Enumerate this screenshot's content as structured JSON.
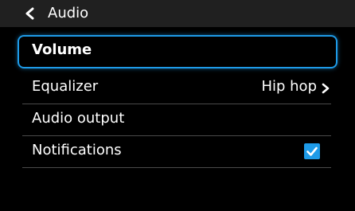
{
  "header": {
    "title": "Audio",
    "back_icon": "chevron-left-icon"
  },
  "menu": {
    "items": [
      {
        "label": "Volume",
        "selected": true
      },
      {
        "label": "Equalizer",
        "value": "Hip hop",
        "icon": "chevron-right-icon"
      },
      {
        "label": "Audio output"
      },
      {
        "label": "Notifications",
        "checked": true,
        "icon": "check-icon"
      }
    ]
  },
  "colors": {
    "background": "#000000",
    "header_background": "#202020",
    "accent": "#1e9be8",
    "divider": "#4a4a4a",
    "text": "#ffffff"
  }
}
